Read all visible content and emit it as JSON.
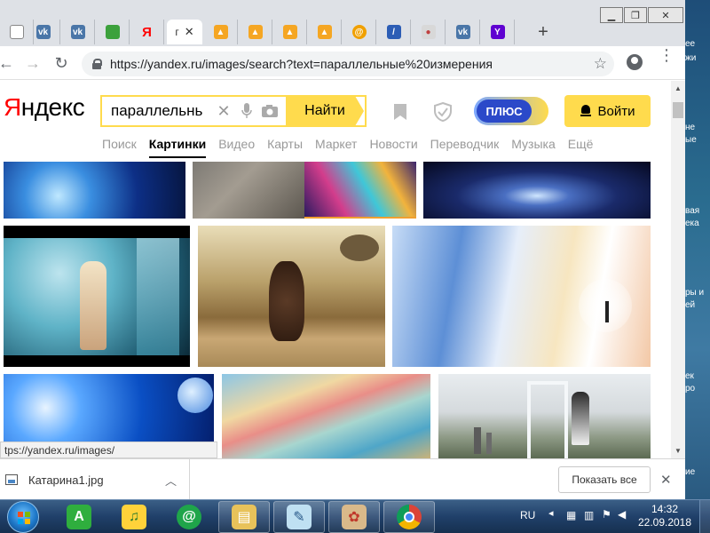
{
  "browser": {
    "active_tab_title": "г",
    "tabs": [
      {
        "icon": "doc-icon",
        "color": "#ffffff"
      },
      {
        "icon": "vk-icon",
        "color": "#4a76a8"
      },
      {
        "icon": "vk-icon",
        "color": "#4a76a8"
      },
      {
        "icon": "green-square-icon",
        "color": "#3ca13c"
      },
      {
        "icon": "yandex-icon",
        "color": "#ff0000"
      },
      {
        "icon": "image-icon",
        "color": "#f5a623"
      },
      {
        "icon": "image-icon",
        "color": "#f5a623"
      },
      {
        "icon": "image-icon",
        "color": "#f5a623"
      },
      {
        "icon": "image-icon",
        "color": "#f5a623"
      },
      {
        "icon": "mail-at-icon",
        "color": "#f0a000"
      },
      {
        "icon": "slash-icon",
        "color": "#2c5db5"
      },
      {
        "icon": "bird-icon",
        "color": "#c04040"
      },
      {
        "icon": "vk-icon",
        "color": "#4a76a8"
      },
      {
        "icon": "yahoo-icon",
        "color": "#5f01d1"
      }
    ],
    "url": "https://yandex.ru/images/search?text=параллельные%20измерения",
    "status_url": "tps://yandex.ru/images/"
  },
  "yandex": {
    "logo_first": "Я",
    "logo_rest": "ндекс",
    "search_query": "параллельнь",
    "find_button": "Найти",
    "plus_label": "ПЛЮС",
    "login_label": "Войти",
    "services": [
      "Поиск",
      "Картинки",
      "Видео",
      "Карты",
      "Маркет",
      "Новости",
      "Переводчик",
      "Музыка",
      "Ещё"
    ],
    "active_service": "Картинки",
    "accent_color": "#ffdb4d"
  },
  "downloads": {
    "file_name": "Катарина1.jpg",
    "show_all": "Показать все"
  },
  "desktop": {
    "side_text": [
      "ее",
      "жи",
      "не",
      "ые",
      "вая",
      "ека",
      "ры и",
      "ей",
      "ек",
      "ро",
      "ие"
    ]
  },
  "taskbar": {
    "language": "RU",
    "time": "14:32",
    "date": "22.09.2018"
  }
}
